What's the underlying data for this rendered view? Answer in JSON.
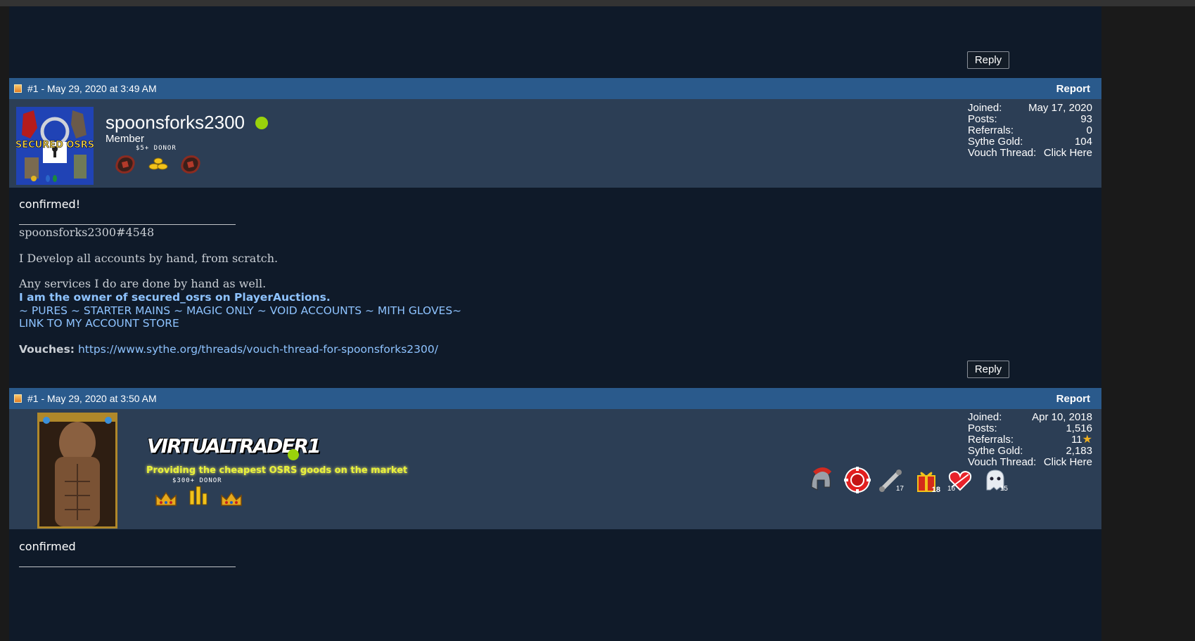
{
  "buttons": {
    "reply": "Reply"
  },
  "posts": [
    {
      "header": "#1 - May 29, 2020 at 3:49 AM",
      "report": "Report",
      "username": "spoonsforks2300",
      "role": "Member",
      "donor_label": "$5+ DONOR",
      "avatar_text": "SECURED OSRS",
      "stats": [
        {
          "label": "Joined:",
          "value": "May 17, 2020"
        },
        {
          "label": "Posts:",
          "value": "93"
        },
        {
          "label": "Referrals:",
          "value": "0"
        },
        {
          "label": "Sythe Gold:",
          "value": "104"
        },
        {
          "label": "Vouch Thread:",
          "value": "Click Here"
        }
      ],
      "body": "confirmed!",
      "signature": {
        "discord": "spoonsforks2300#4548",
        "line1": "I Develop all accounts by hand, from scratch.",
        "line2": "Any services I do are done by hand as well.",
        "owner": "I am the owner of secured_osrs on PlayerAuctions.",
        "categories": "~ PURES ~ STARTER MAINS ~ MAGIC ONLY ~ VOID ACCOUNTS ~ MITH GLOVES~",
        "store_link": "LINK TO MY ACCOUNT STORE",
        "vouches_label": "Vouches:",
        "vouches_url": "https://www.sythe.org/threads/vouch-thread-for-spoonsforks2300/"
      }
    },
    {
      "header": "#1 - May 29, 2020 at 3:50 AM",
      "report": "Report",
      "username": "VIRTUALTRADER1",
      "tagline": "Providing the cheapest OSRS goods on the market",
      "donor_label": "$300+ DONOR",
      "stats": [
        {
          "label": "Joined:",
          "value": "Apr 10, 2018"
        },
        {
          "label": "Posts:",
          "value": "1,516"
        },
        {
          "label": "Referrals:",
          "value": "11"
        },
        {
          "label": "Sythe Gold:",
          "value": "2,183"
        },
        {
          "label": "Vouch Thread:",
          "value": "Click Here"
        }
      ],
      "award_counts": [
        "17",
        "18",
        "16",
        "15"
      ],
      "body": "confirmed"
    }
  ],
  "colors": {
    "accent_header": "#2a5a8c",
    "userbar": "#2c3e55",
    "background": "#0f1a29",
    "online": "#9ad20b",
    "link": "#8ec3ff",
    "tagline": "#e8f23a"
  }
}
